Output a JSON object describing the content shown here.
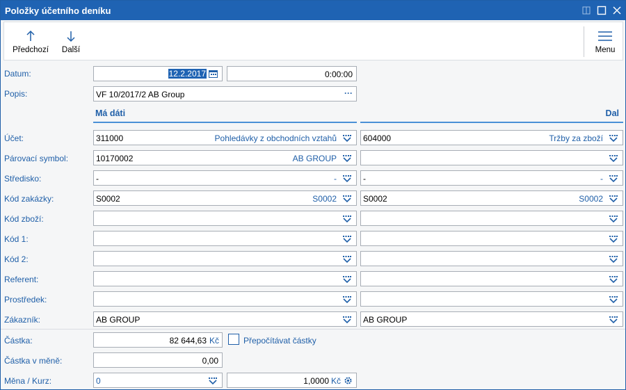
{
  "window": {
    "title": "Položky účetního deníku"
  },
  "toolbar": {
    "prev_label": "Předchozí",
    "next_label": "Další",
    "menu_label": "Menu"
  },
  "labels": {
    "datum": "Datum:",
    "popis": "Popis:",
    "ucet": "Účet:",
    "parovaci": "Párovací symbol:",
    "stredisko": "Středisko:",
    "kod_zakazky": "Kód zakázky:",
    "kod_zbozi": "Kód zboží:",
    "kod1": "Kód 1:",
    "kod2": "Kód 2:",
    "referent": "Referent:",
    "prostredek": "Prostředek:",
    "zakaznik": "Zákazník:",
    "castka": "Částka:",
    "castka_mene": "Částka v měně:",
    "mena_kurz": "Měna / Kurz:"
  },
  "columns": {
    "debit": "Má dáti",
    "credit": "Dal"
  },
  "fields": {
    "date": "12.2.2017",
    "time": "0:00:00",
    "popis": "VF 10/2017/2 AB Group",
    "popis_more": "···",
    "ucet_md": "311000",
    "ucet_md_name": "Pohledávky z obchodních vztahů",
    "ucet_d": "604000",
    "ucet_d_name": "Tržby za zboží",
    "par_md": "10170002",
    "par_md_name": "AB GROUP",
    "str_md": "-",
    "str_md_name": "-",
    "str_d": "-",
    "str_d_name": "-",
    "zak_md": "S0002",
    "zak_md_name": "S0002",
    "zak_d": "S0002",
    "zak_d_name": "S0002",
    "zakaznik_md": "AB GROUP",
    "zakaznik_d": "AB GROUP",
    "castka": "82 644,63",
    "castka_unit": "Kč",
    "prepocitavat": "Přepočítávat částky",
    "castka_mene": "0,00",
    "mena": "0",
    "kurz": "1,0000",
    "kurz_unit": "Kč"
  },
  "colors": {
    "accent": "#1f63b3",
    "label": "#1f5fa8"
  }
}
